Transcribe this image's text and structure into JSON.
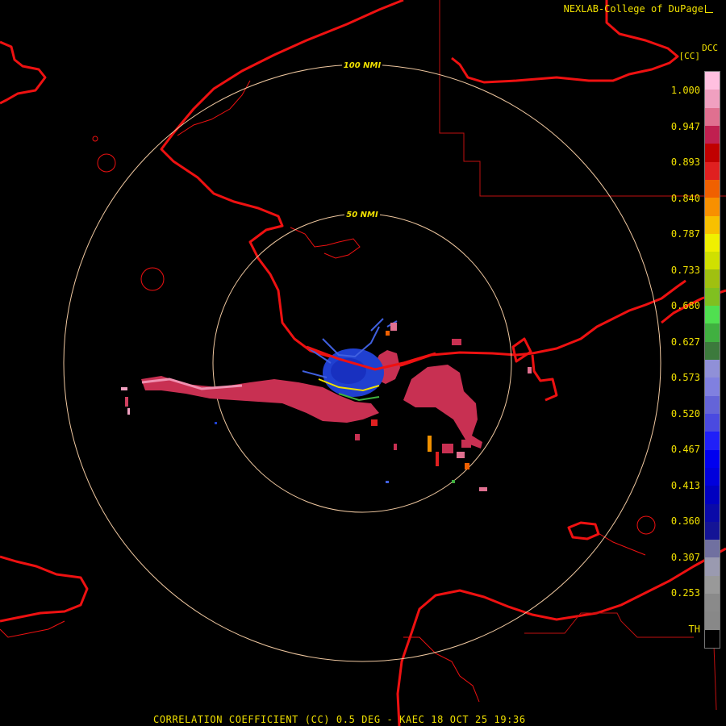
{
  "credit": "NEXLAB-College of DuPage",
  "credit_icon": "external-link-icon",
  "product_code": "DCC",
  "unit_label": "[CC]",
  "footer": "CORRELATION COEFFICIENT (CC) 0.5 DEG - KAEC 18 OCT 25 19:36",
  "range_rings": [
    {
      "label": "100 NMI"
    },
    {
      "label": "50 NMI"
    }
  ],
  "colorbar": {
    "ticks": [
      "1.000",
      "0.947",
      "0.893",
      "0.840",
      "0.787",
      "0.733",
      "0.680",
      "0.627",
      "0.573",
      "0.520",
      "0.467",
      "0.413",
      "0.360",
      "0.307",
      "0.253",
      "TH"
    ],
    "colors": [
      "#000000",
      "#888888",
      "#8a8a8a",
      "#999999",
      "#9a9ab0",
      "#7070a0",
      "#141496",
      "#0a0aa8",
      "#0000c0",
      "#0000dc",
      "#0000f0",
      "#2020f8",
      "#4a4ae0",
      "#6464d8",
      "#8080e0",
      "#9090d8",
      "#3c7a3c",
      "#40b040",
      "#50e050",
      "#80c020",
      "#a0c010",
      "#d0e000",
      "#f0f000",
      "#f8c000",
      "#f89000",
      "#f06000",
      "#e02020",
      "#c00000",
      "#c02050",
      "#e07090",
      "#f0a0c0",
      "#ffc0e0"
    ]
  },
  "colors": {
    "text": "#f0e000",
    "coast": "#ee1111",
    "ring": "#f0c8a0",
    "state_line": "#c01010"
  }
}
